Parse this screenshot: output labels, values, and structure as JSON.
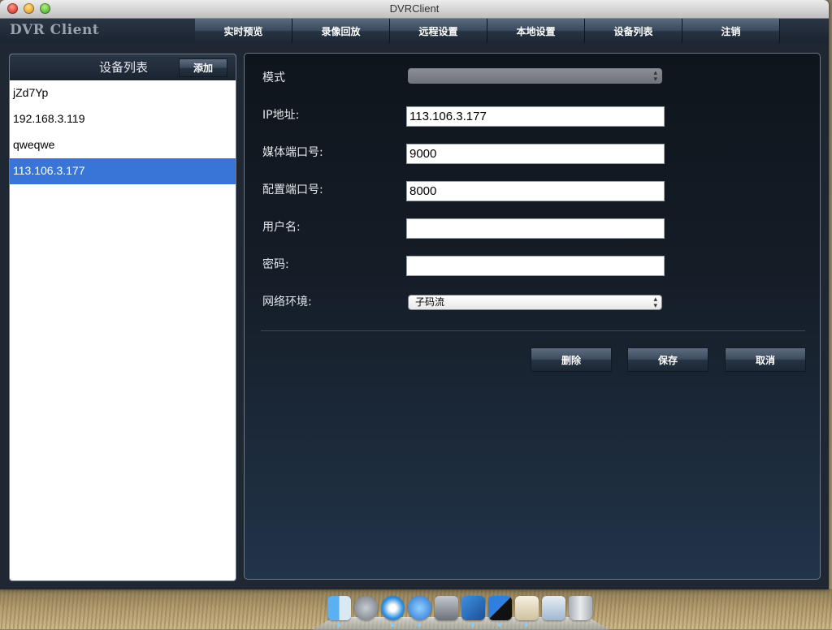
{
  "window": {
    "title": "DVRClient"
  },
  "app": {
    "logo": "DVR Client",
    "nav": [
      "实时预览",
      "录像回放",
      "远程设置",
      "本地设置",
      "设备列表",
      "注销"
    ]
  },
  "device_panel": {
    "title": "设备列表",
    "add_label": "添加",
    "devices": [
      "jZd7Yp",
      "192.168.3.119",
      "qweqwe",
      "113.106.3.177"
    ],
    "selected_index": 3
  },
  "form": {
    "mode_label": "模式",
    "mode_value": "",
    "ip_label": "IP地址:",
    "ip_value": "113.106.3.177",
    "media_port_label": "媒体端口号:",
    "media_port_value": "9000",
    "config_port_label": "配置端口号:",
    "config_port_value": "8000",
    "username_label": "用户名:",
    "username_value": "",
    "password_label": "密码:",
    "password_value": "",
    "network_label": "网络环境:",
    "network_value": "子码流"
  },
  "actions": {
    "delete": "删除",
    "save": "保存",
    "cancel": "取消"
  },
  "dock": {
    "icons": [
      "finder-icon",
      "launchpad-icon",
      "safari-icon",
      "itunes-icon",
      "system-preferences-icon",
      "xcode-icon",
      "app-icon",
      "textedit-icon",
      "preview-icon",
      "trash-icon"
    ]
  }
}
